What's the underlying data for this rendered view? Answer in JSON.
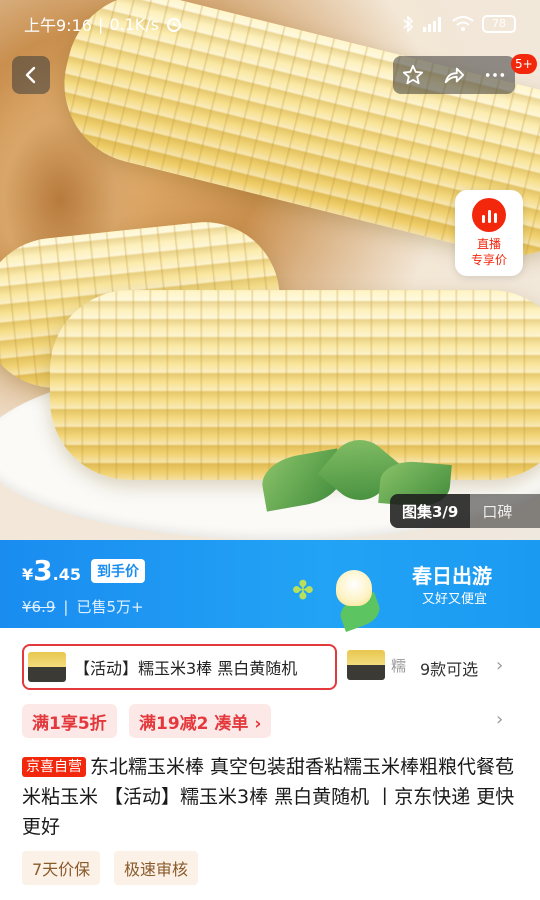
{
  "status_bar": {
    "time": "上午9:16",
    "speed": "0.1K/s",
    "battery": "78"
  },
  "top_actions": {
    "message_badge": "5+"
  },
  "live": {
    "line1": "直播",
    "line2": "专享价"
  },
  "gallery": {
    "active_label": "图集3/9",
    "other_label": "口碑"
  },
  "price": {
    "yen": "¥",
    "integer": "3",
    "decimal": ".45",
    "tag": "到手价",
    "original": "¥6.9",
    "sold": "已售5万+"
  },
  "promo": {
    "title": "春日出游",
    "subtitle": "又好又便宜"
  },
  "variants": {
    "selected_label": "【活动】糯玉米3棒 黑白黄随机",
    "other_label": "糯",
    "count_label": "9款可选"
  },
  "coupons": [
    {
      "label": "满1享5折"
    },
    {
      "label": "满19减2  凑单 ›"
    }
  ],
  "product": {
    "self_tag": "京喜自营",
    "title": "东北糯玉米棒 真空包装甜香粘糯玉米棒粗粮代餐苞米粘玉米 【活动】糯玉米3棒 黑白黄随机 丨京东快递 更快更好"
  },
  "services": [
    {
      "label": "7天价保"
    },
    {
      "label": "极速审核"
    }
  ],
  "colors": {
    "accent_red": "#f2270c",
    "banner_blue": "#1a8cf0"
  }
}
